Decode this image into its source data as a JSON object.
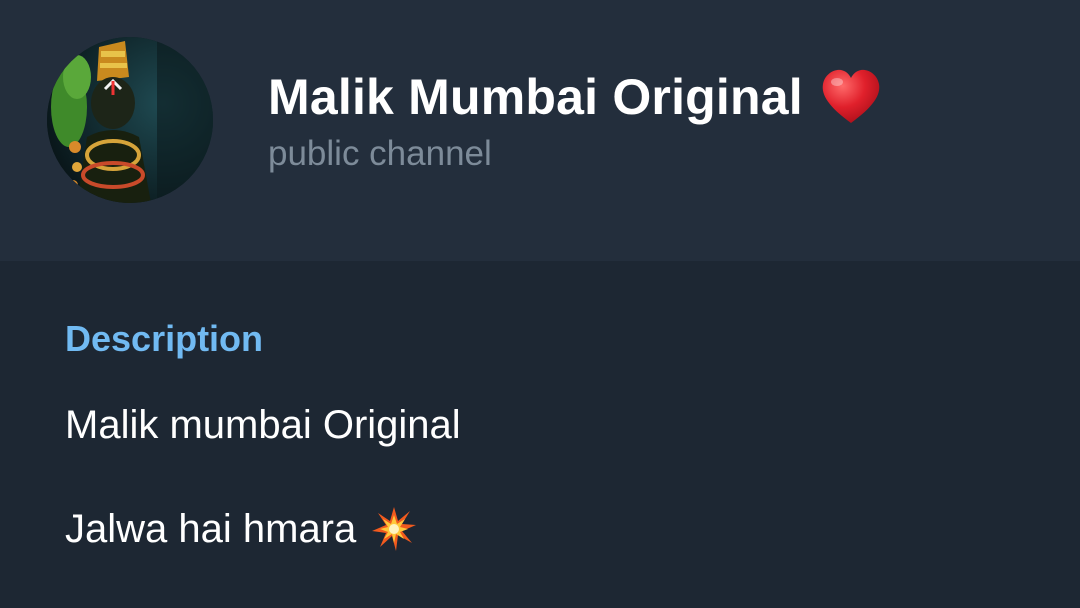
{
  "header": {
    "channel_name": "Malik Mumbai Original",
    "channel_type": "public channel",
    "name_emoji": "red-heart-icon",
    "avatar": "deity-avatar"
  },
  "description": {
    "title": "Description",
    "lines": [
      "Malik mumbai Original",
      "Jalwa hai hmara"
    ],
    "line_2_emoji": "collision-icon"
  },
  "colors": {
    "header_bg": "#232e3c",
    "body_bg": "#1d2733",
    "title_text": "#ffffff",
    "subtitle_text": "#7d8b99",
    "accent_blue": "#71baf2",
    "heart_red": "#e0202b"
  }
}
